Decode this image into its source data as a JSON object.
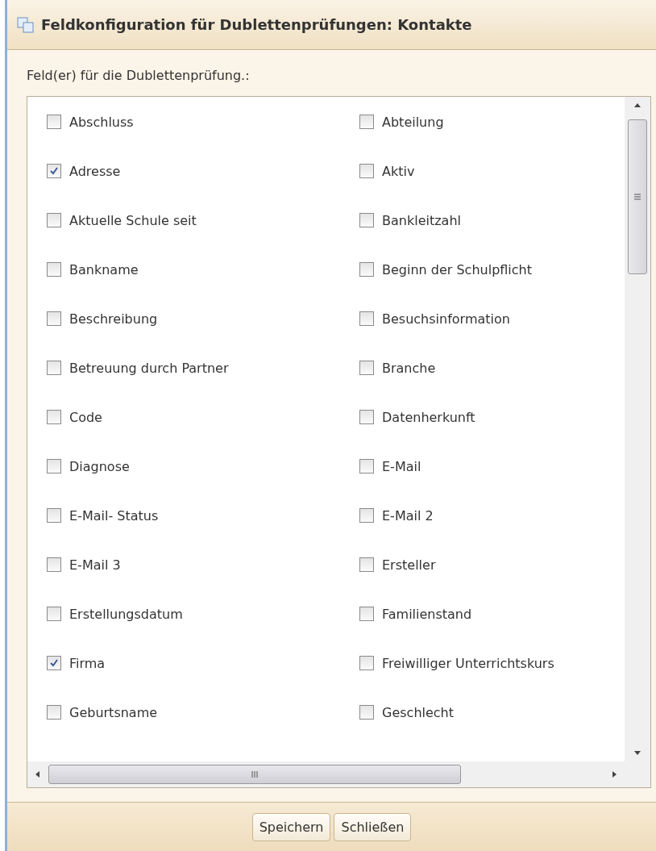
{
  "dialog": {
    "title": "Feldkonfiguration für Dublettenprüfungen: Kontakte"
  },
  "label": "Feld(er) für die Dublettenprüfung.:",
  "fields": [
    {
      "label": "Abschluss",
      "checked": false
    },
    {
      "label": "Abteilung",
      "checked": false
    },
    {
      "label": "Adresse",
      "checked": true
    },
    {
      "label": "Aktiv",
      "checked": false
    },
    {
      "label": "Aktuelle Schule seit",
      "checked": false
    },
    {
      "label": "Bankleitzahl",
      "checked": false
    },
    {
      "label": "Bankname",
      "checked": false
    },
    {
      "label": "Beginn der Schulpflicht",
      "checked": false
    },
    {
      "label": "Beschreibung",
      "checked": false
    },
    {
      "label": "Besuchsinformation",
      "checked": false
    },
    {
      "label": "Betreuung durch Partner",
      "checked": false
    },
    {
      "label": "Branche",
      "checked": false
    },
    {
      "label": "Code",
      "checked": false
    },
    {
      "label": "Datenherkunft",
      "checked": false
    },
    {
      "label": "Diagnose",
      "checked": false
    },
    {
      "label": "E-Mail",
      "checked": false
    },
    {
      "label": "E-Mail- Status",
      "checked": false
    },
    {
      "label": "E-Mail 2",
      "checked": false
    },
    {
      "label": "E-Mail 3",
      "checked": false
    },
    {
      "label": "Ersteller",
      "checked": false
    },
    {
      "label": "Erstellungsdatum",
      "checked": false
    },
    {
      "label": "Familienstand",
      "checked": false
    },
    {
      "label": "Firma",
      "checked": true
    },
    {
      "label": "Freiwilliger Unterrichtskurs",
      "checked": false
    },
    {
      "label": "Geburtsname",
      "checked": false
    },
    {
      "label": "Geschlecht",
      "checked": false
    }
  ],
  "buttons": [
    {
      "label": "Speichern"
    },
    {
      "label": "Schließen"
    }
  ]
}
